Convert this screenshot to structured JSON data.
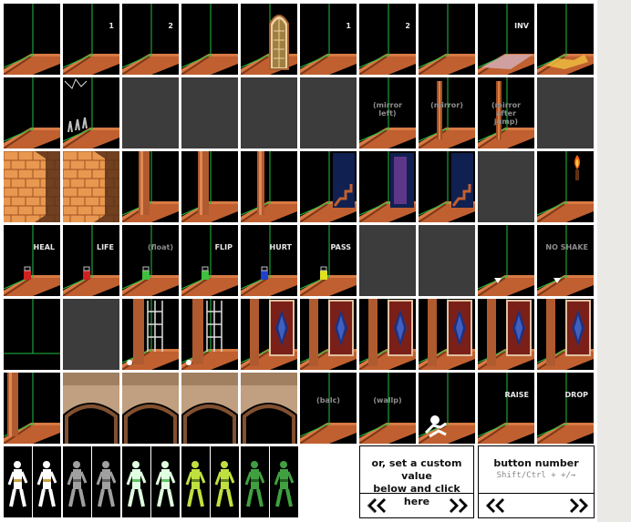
{
  "grid": {
    "rows": [
      [
        {
          "label": "",
          "kind": "floor"
        },
        {
          "label": "1",
          "kind": "floor"
        },
        {
          "label": "2",
          "kind": "floor"
        },
        {
          "label": "",
          "kind": "floor"
        },
        {
          "label": "",
          "kind": "window"
        },
        {
          "label": "1",
          "kind": "floor"
        },
        {
          "label": "2",
          "kind": "floor"
        },
        {
          "label": "",
          "kind": "floor"
        },
        {
          "label": "INV",
          "kind": "floor-pink"
        },
        {
          "label": "",
          "kind": "floor-debris"
        }
      ],
      [
        {
          "label": "",
          "kind": "floor"
        },
        {
          "label": "",
          "kind": "spikes"
        },
        {
          "label": "",
          "kind": "gray"
        },
        {
          "label": "",
          "kind": "gray"
        },
        {
          "label": "",
          "kind": "gray"
        },
        {
          "label": "",
          "kind": "gray"
        },
        {
          "label": "(mirror left)",
          "kind": "floor-dim"
        },
        {
          "label": "(mirror)",
          "kind": "mirror"
        },
        {
          "label": "(mirror after jump)",
          "kind": "mirror"
        },
        {
          "label": "",
          "kind": "gray"
        }
      ],
      [
        {
          "label": "",
          "kind": "brick"
        },
        {
          "label": "",
          "kind": "brick2"
        },
        {
          "label": "",
          "kind": "pillar"
        },
        {
          "label": "",
          "kind": "pillar-dotted"
        },
        {
          "label": "",
          "kind": "pillar-thin"
        },
        {
          "label": "",
          "kind": "stairs"
        },
        {
          "label": "",
          "kind": "tapestry"
        },
        {
          "label": "",
          "kind": "stairs2"
        },
        {
          "label": "",
          "kind": "gray"
        },
        {
          "label": "",
          "kind": "torch"
        }
      ],
      [
        {
          "label": "HEAL",
          "kind": "potion",
          "potion": "#d02020"
        },
        {
          "label": "LIFE",
          "kind": "potion",
          "potion": "#d02020"
        },
        {
          "label": "(float)",
          "kind": "potion-dim",
          "potion": "#40c040"
        },
        {
          "label": "FLIP",
          "kind": "potion",
          "potion": "#40c040"
        },
        {
          "label": "HURT",
          "kind": "potion",
          "potion": "#2040d0"
        },
        {
          "label": "PASS",
          "kind": "potion",
          "potion": "#e0e020"
        },
        {
          "label": "",
          "kind": "gray"
        },
        {
          "label": "",
          "kind": "gray"
        },
        {
          "label": "",
          "kind": "floor-arrow"
        },
        {
          "label": "NO SHAKE",
          "kind": "floor-arrow-dim"
        }
      ],
      [
        {
          "label": "",
          "kind": "corner"
        },
        {
          "label": "",
          "kind": "gray"
        },
        {
          "label": "",
          "kind": "gate"
        },
        {
          "label": "",
          "kind": "gate2"
        },
        {
          "label": "",
          "kind": "door"
        },
        {
          "label": "",
          "kind": "door"
        },
        {
          "label": "",
          "kind": "door"
        },
        {
          "label": "",
          "kind": "door"
        },
        {
          "label": "",
          "kind": "door"
        },
        {
          "label": "",
          "kind": "door"
        }
      ],
      [
        {
          "label": "",
          "kind": "pillar-left"
        },
        {
          "label": "",
          "kind": "arch"
        },
        {
          "label": "",
          "kind": "arch"
        },
        {
          "label": "",
          "kind": "arch"
        },
        {
          "label": "",
          "kind": "arch"
        },
        {
          "label": "(balc)",
          "kind": "floor-dim"
        },
        {
          "label": "(wallp)",
          "kind": "floor-dim"
        },
        {
          "label": "",
          "kind": "skeleton"
        },
        {
          "label": "RAISE",
          "kind": "floor"
        },
        {
          "label": "DROP",
          "kind": "floor"
        }
      ]
    ]
  },
  "guards": [
    {
      "body": "#ffffff",
      "accent": "#c8a040"
    },
    {
      "body": "#ffffff",
      "accent": "#c8a040"
    },
    {
      "body": "#a0a0a0",
      "accent": "#606060"
    },
    {
      "body": "#a0a0a0",
      "accent": "#606060"
    },
    {
      "body": "#e0ffe0",
      "accent": "#60c060"
    },
    {
      "body": "#e0ffe0",
      "accent": "#60c060"
    },
    {
      "body": "#c0e040",
      "accent": "#608020"
    },
    {
      "body": "#c0e040",
      "accent": "#608020"
    },
    {
      "body": "#40a040",
      "accent": "#206020"
    },
    {
      "body": "#40a040",
      "accent": "#206020"
    }
  ],
  "custom_panel": {
    "text_line1": "or, set a custom value",
    "text_line2": "below and click here"
  },
  "button_panel": {
    "title": "button number",
    "hint": "Shift/Ctrl + +/→"
  },
  "colors": {
    "floor_top": "#c06030",
    "floor_side": "#803818",
    "wall_line": "#20c040",
    "brick": "#e89850",
    "gray_tile": "#3c3c3c"
  }
}
